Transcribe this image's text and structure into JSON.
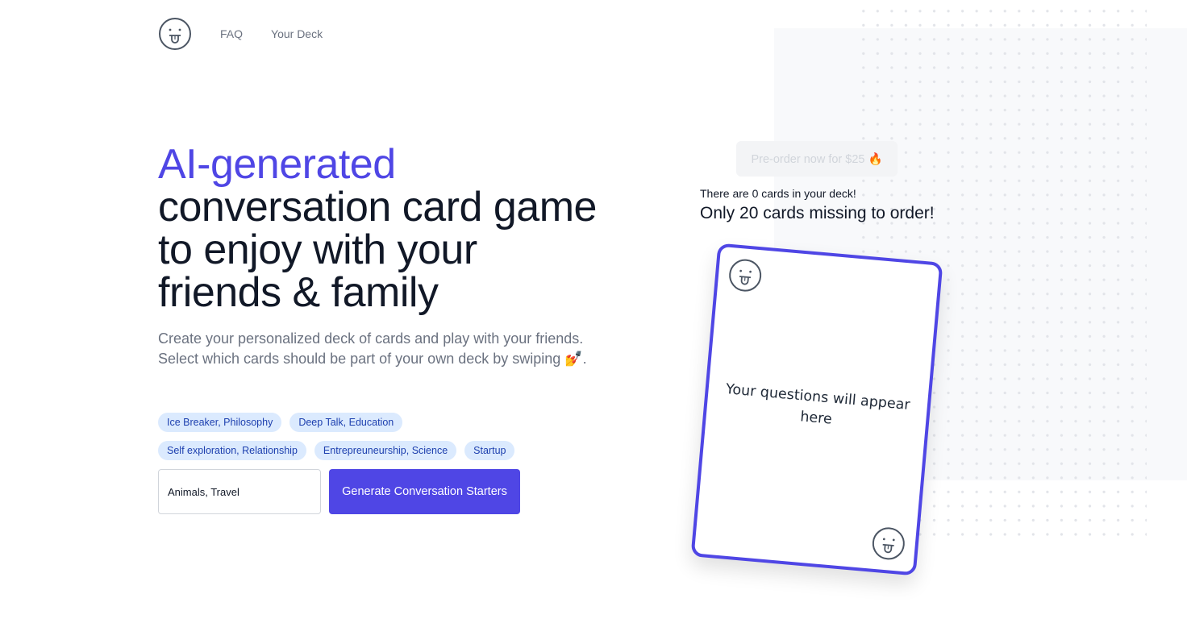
{
  "nav": {
    "logo_icon": "tongue-face-icon",
    "links": [
      {
        "label": "FAQ"
      },
      {
        "label": "Your Deck"
      }
    ]
  },
  "hero": {
    "title_accent": "AI-generated",
    "title_rest": "conversation card game to enjoy with your friends & family",
    "subtitle_line1": "Create your personalized deck of cards and play with your friends.",
    "subtitle_line2": "Select which cards should be part of your own deck by swiping 💅."
  },
  "tags": {
    "row1": [
      "Ice Breaker, Philosophy",
      "Deep Talk, Education"
    ],
    "row2": [
      "Self exploration, Relationship",
      "Entrepreuneurship, Science",
      "Startup"
    ]
  },
  "form": {
    "topic_input_value": "Animals, Travel",
    "generate_label": "Generate Conversation Starters"
  },
  "order": {
    "preorder_label": "Pre-order now for $25 🔥",
    "deck_count_text": "There are 0 cards in your deck!",
    "missing_text": "Only 20 cards missing to order!"
  },
  "card": {
    "placeholder_text": "Your questions will appear here",
    "corner_icon": "tongue-face-icon"
  },
  "colors": {
    "accent": "#4f46e5",
    "tag_bg": "#dbeafe",
    "tag_text": "#1e40af",
    "muted_text": "#6b7280"
  }
}
